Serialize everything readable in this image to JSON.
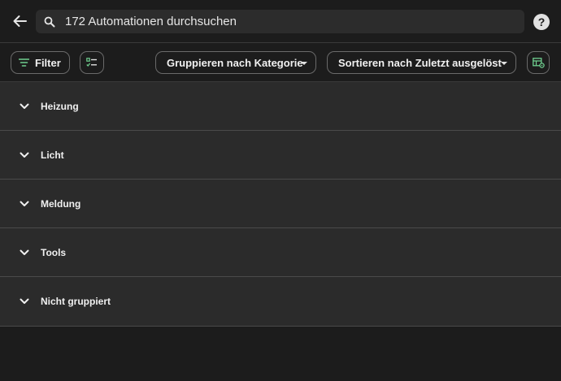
{
  "search": {
    "placeholder": "172 Automationen durchsuchen",
    "value": ""
  },
  "toolbar": {
    "filter_label": "Filter",
    "group_label": "Gruppieren nach Kategorie",
    "sort_label": "Sortieren nach Zuletzt ausgelöst"
  },
  "help_glyph": "?",
  "groups": [
    {
      "label": "Heizung"
    },
    {
      "label": "Licht"
    },
    {
      "label": "Meldung"
    },
    {
      "label": "Tools"
    },
    {
      "label": "Nicht gruppiert"
    }
  ],
  "colors": {
    "accent": "#6fcf8f",
    "background": "#1c1c1c",
    "surface": "#2b2b2b"
  },
  "icons": {
    "back": "arrow-left-icon",
    "search": "magnify-icon",
    "help": "help-circle-icon",
    "filter": "filter-variant-icon",
    "select": "checklist-icon",
    "settings": "table-cog-icon",
    "expand": "chevron-down-icon"
  }
}
